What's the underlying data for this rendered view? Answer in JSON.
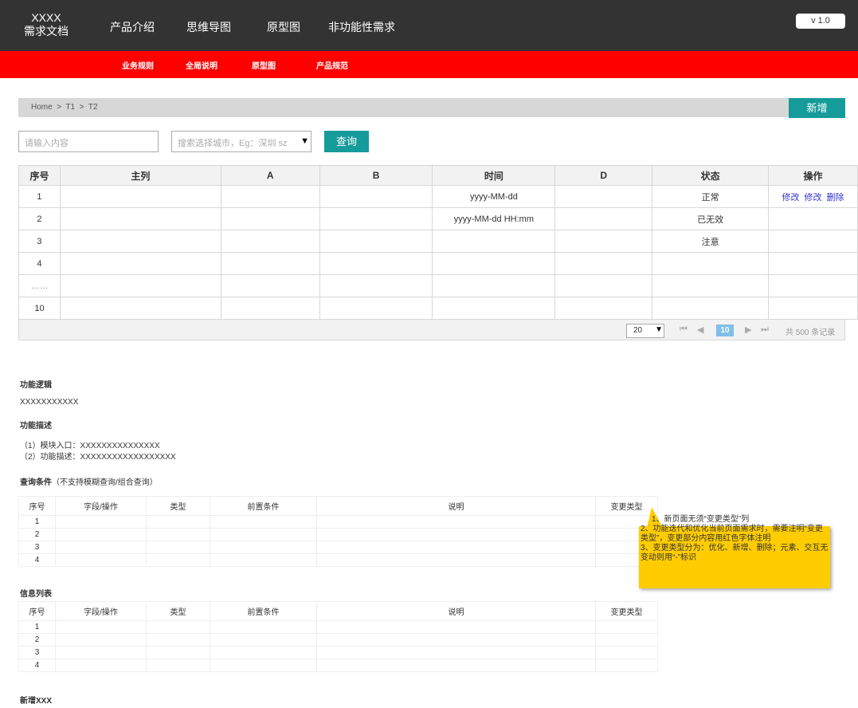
{
  "header": {
    "logo_line1": "XXXX",
    "logo_line2": "需求文档",
    "nav": [
      "产品介绍",
      "思维导图",
      "原型图",
      "非功能性需求"
    ],
    "version": "v 1.0"
  },
  "subnav": [
    "业务规则",
    "全局说明",
    "原型图",
    "产品规范"
  ],
  "breadcrumb": "Home  >  T1  >  T2",
  "add_button": "新增",
  "filters": {
    "input_placeholder": "请输入内容",
    "select_placeholder": "搜索选择城市，Eg：深圳 sz",
    "query_button": "查询"
  },
  "main_table": {
    "headers": [
      "序号",
      "主列",
      "A",
      "B",
      "时间",
      "D",
      "状态",
      "操作"
    ],
    "rows": [
      [
        "1",
        "",
        "",
        "",
        "yyyy-MM-dd",
        "",
        "正常",
        ""
      ],
      [
        "2",
        "",
        "",
        "",
        "yyyy-MM-dd HH:mm",
        "",
        "已无效",
        ""
      ],
      [
        "3",
        "",
        "",
        "",
        "",
        "",
        "注意",
        ""
      ],
      [
        "4",
        "",
        "",
        "",
        "",
        "",
        "",
        ""
      ],
      [
        "……",
        "",
        "",
        "",
        "",
        "",
        "",
        ""
      ],
      [
        "10",
        "",
        "",
        "",
        "",
        "",
        "",
        ""
      ]
    ],
    "row1_actions": [
      "修改",
      "修改",
      "删除"
    ]
  },
  "pager": {
    "page_size": "20",
    "current_page": "10",
    "total": "共 500 条记录"
  },
  "doc": {
    "logic_title": "功能逻辑",
    "logic_text": "XXXXXXXXXXX",
    "desc_title": "功能描述",
    "desc_line1": "（1）模块入口：XXXXXXXXXXXXXXX",
    "desc_line2": "（2）功能描述：XXXXXXXXXXXXXXXXXX",
    "query_title": "查询条件",
    "query_note": "（不支持模糊查询/组合查询）",
    "list_title": "信息列表",
    "add_title": "新增XXX"
  },
  "spec_table": {
    "headers": [
      "序号",
      "字段/操作",
      "类型",
      "前置条件",
      "说明",
      "变更类型"
    ],
    "rows": [
      "1",
      "2",
      "3",
      "4"
    ]
  },
  "note": {
    "line1": "1、新页面无须“变更类型”列",
    "line2": "2、功能迭代和优化当前页面需求时，需要注明“变更类型”，变更部分内容用红色字体注明",
    "line3": "3、变更类型分为：优化、新增、删除；元素、交互无变动则用“-”标识"
  },
  "colors": {
    "topbar": "#333333",
    "subbar": "#ff0000",
    "accent": "#169b9b",
    "note": "#ffcc00"
  }
}
